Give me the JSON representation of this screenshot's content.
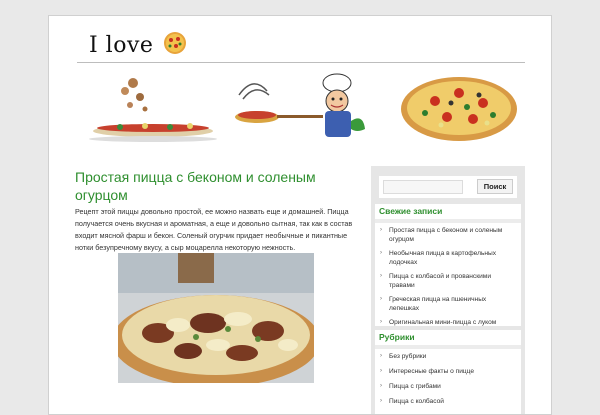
{
  "header": {
    "logo_text": "I love",
    "banner_images": [
      "pizza-toppings-falling",
      "chef-with-pizza-peel",
      "whole-pizza"
    ]
  },
  "post": {
    "title": "Простая пицца с беконом и соленым огурцом",
    "text": "Рецепт этой пиццы довольно простой, ее можно назвать еще и домашней. Пицца получается очень вкусная и ароматная, а еще и довольно сытная, так как в состав входит мясной фарш и бекон. Соленый огурчик придает необычные и пикантные нотки безупречному вкусу, а сыр моцарелла некоторую нежность."
  },
  "sidebar": {
    "search": {
      "placeholder": "",
      "button_label": "Поиск"
    },
    "recent_title": "Свежие записи",
    "recent_posts": [
      "Простая пицца с беконом и соленым огурцом",
      "Необычная пицца в картофельных лодочках",
      "Пицца с колбасой и прованскими травами",
      "Греческая пицца на пшеничных лепешках",
      "Оригинальная мини-пицца с луком"
    ],
    "categories_title": "Рубрики",
    "categories": [
      "Без рубрики",
      "Интересные факты о пицце",
      "Пицца с грибами",
      "Пицца с колбасой"
    ]
  },
  "colors": {
    "accent": "#2f8f2f",
    "sidebar_bg": "#e6e6e6"
  }
}
